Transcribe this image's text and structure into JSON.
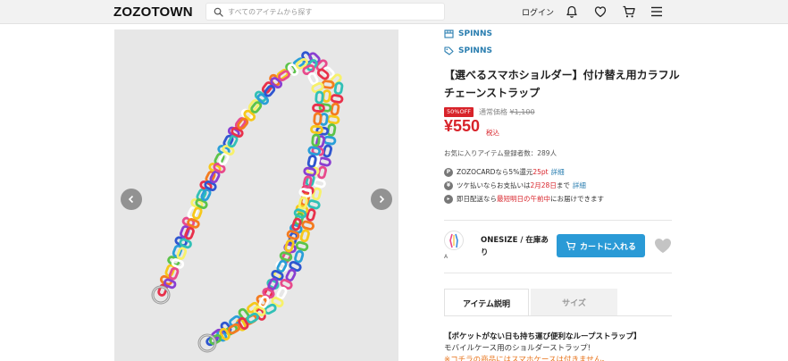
{
  "header": {
    "logo": "ZOZOTOWN",
    "search_placeholder": "すべてのアイテムから探す",
    "login_label": "ログイン",
    "icons": [
      "bell-icon",
      "heart-icon",
      "cart-icon",
      "menu-icon"
    ]
  },
  "gallery": {
    "prev_icon": "chevron-left-icon",
    "next_icon": "chevron-right-icon",
    "image_subject": "colorful acrylic chain phone strap"
  },
  "product": {
    "brand_shop": "SPINNS",
    "brand_tag": "SPINNS",
    "title": "【選べるスマホショルダー】付け替え用カラフルチェーンストラップ",
    "discount_badge": "50%OFF",
    "regular_label": "通常価格",
    "regular_price": "¥1,100",
    "price": "¥550",
    "tax_label": "税込",
    "favorites": "お気に入りアイテム登録者数：289人",
    "info": {
      "card_pre": "ZOZOCARDなら5%還元",
      "card_pt": "25pt",
      "card_link": "詳細",
      "tsuke_pre": "ツケ払いならお支払いは",
      "tsuke_date": "2月28日",
      "tsuke_post": "まで",
      "tsuke_link": "詳細",
      "ship_pre": "即日配送なら",
      "ship_red": "最短明日の午前中",
      "ship_post": "にお届けできます"
    },
    "variant": {
      "thumb_caption": "A",
      "size_stock": "ONESIZE / 在庫あり",
      "cart_label": "カートに入れる"
    }
  },
  "tabs": [
    {
      "label": "アイテム説明",
      "active": true
    },
    {
      "label": "サイズ",
      "active": false
    }
  ],
  "description": {
    "heading": "【ポケットがない日も持ち運び便利なループストラップ】",
    "line1": "モバイルケース用のショルダーストラップ!",
    "warning": "※コチラの商品にはスマホケースは付きません。"
  },
  "colors": {
    "accent_blue": "#2a9ad6",
    "brand_link": "#2a7eb0",
    "sale_red": "#d8232a",
    "warning_orange": "#e8731a"
  }
}
